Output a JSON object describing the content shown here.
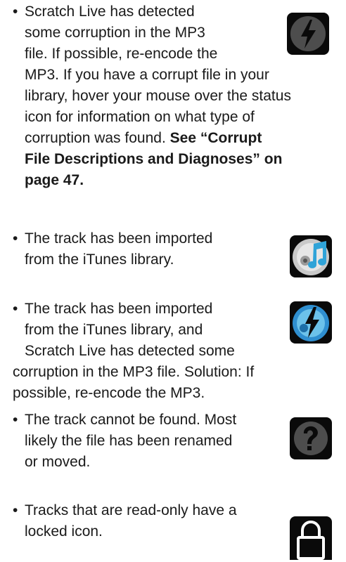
{
  "items": [
    {
      "icon": "corrupt-file-icon",
      "lines": [
        "Scratch Live has detected",
        "some corruption in the MP3",
        "file. If possible, re-encode the",
        "MP3. If you have a corrupt file in your",
        "library, hover your mouse over the status",
        "icon for information on what type of",
        "corruption was found."
      ],
      "bold_lines": [
        "See “Corrupt",
        "File Descriptions and Diagnoses” on",
        "page 47."
      ]
    },
    {
      "icon": "itunes-icon",
      "lines": [
        "The track has been imported",
        "from the iTunes library."
      ]
    },
    {
      "icon": "itunes-corrupt-icon",
      "lines": [
        "The track has been imported",
        "from the iTunes library, and",
        "Scratch Live has detected some",
        "corruption in the MP3 file. Solution: If",
        "possible, re-encode the MP3."
      ]
    },
    {
      "icon": "missing-file-icon",
      "lines": [
        "The track cannot be found. Most",
        "likely the file has been renamed",
        "or moved."
      ]
    },
    {
      "icon": "lock-icon",
      "lines": [
        "Tracks that are read-only have a",
        "locked icon."
      ]
    }
  ]
}
